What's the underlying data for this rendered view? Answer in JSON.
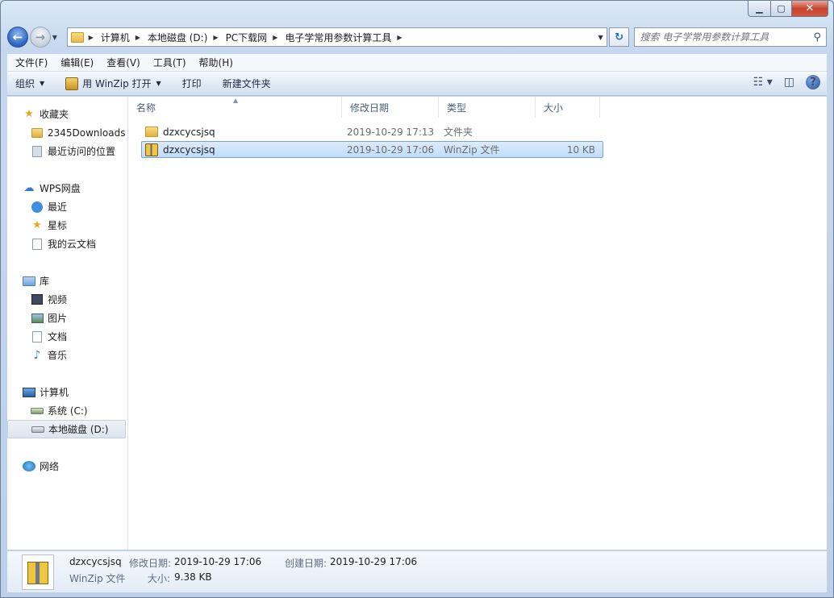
{
  "window": {
    "minimize_glyph": "▁",
    "maximize_glyph": "▢",
    "close_glyph": "✕"
  },
  "address": {
    "crumbs": [
      "计算机",
      "本地磁盘 (D:)",
      "PC下载网",
      "电子学常用参数计算工具"
    ],
    "search_placeholder": "搜索 电子学常用参数计算工具"
  },
  "menubar": {
    "items": [
      "文件(F)",
      "编辑(E)",
      "查看(V)",
      "工具(T)",
      "帮助(H)"
    ]
  },
  "toolbar": {
    "organize": "组织",
    "open_with": "用 WinZip 打开",
    "print": "打印",
    "new_folder": "新建文件夹"
  },
  "sidebar": {
    "favorites": {
      "label": "收藏夹",
      "items": [
        "2345Downloads",
        "最近访问的位置"
      ]
    },
    "wps": {
      "label": "WPS网盘",
      "items": [
        "最近",
        "星标",
        "我的云文档"
      ]
    },
    "libraries": {
      "label": "库",
      "items": [
        "视频",
        "图片",
        "文档",
        "音乐"
      ]
    },
    "computer": {
      "label": "计算机",
      "items": [
        "系统 (C:)",
        "本地磁盘 (D:)"
      ]
    },
    "network": {
      "label": "网络"
    }
  },
  "columns": {
    "name": "名称",
    "date": "修改日期",
    "type": "类型",
    "size": "大小"
  },
  "files": [
    {
      "name": "dzxcycsjsq",
      "date": "2019-10-29 17:13",
      "type": "文件夹",
      "size": "",
      "icon": "folder-icon",
      "selected": false
    },
    {
      "name": "dzxcycsjsq",
      "date": "2019-10-29 17:06",
      "type": "WinZip 文件",
      "size": "10 KB",
      "icon": "winzip-file-icon",
      "selected": true
    }
  ],
  "details": {
    "name": "dzxcycsjsq",
    "type": "WinZip 文件",
    "modified_label": "修改日期:",
    "modified_value": "2019-10-29 17:06",
    "created_label": "创建日期:",
    "created_value": "2019-10-29 17:06",
    "size_label": "大小:",
    "size_value": "9.38 KB"
  }
}
